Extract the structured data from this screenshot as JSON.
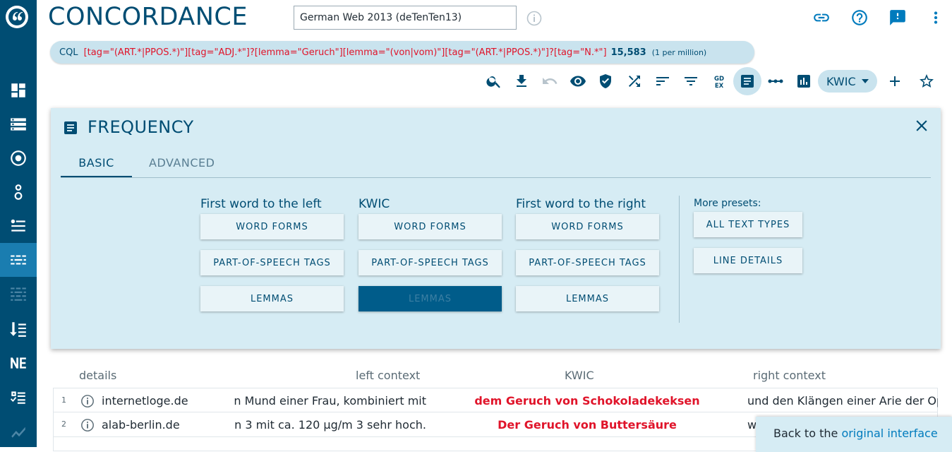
{
  "header": {
    "title": "CONCORDANCE",
    "corpus": "German Web 2013 (deTenTen13)"
  },
  "cql": {
    "label": "CQL",
    "query": "[tag=\"(ART.*|PPOS.*)\"][tag=\"ADJ.*\"]?[lemma=\"Geruch\"][lemma=\"(von|vom)\"][tag=\"(ART.*|PPOS.*)\"]?[tag=\"N.*\"]",
    "count": "15,583",
    "per_million": "(1 per million)"
  },
  "toolbar": {
    "view_mode": "KWIC"
  },
  "frequency": {
    "title": "FREQUENCY",
    "tabs": [
      "BASIC",
      "ADVANCED"
    ],
    "columns": [
      {
        "heading": "First word to the left",
        "buttons": [
          "WORD FORMS",
          "PART-OF-SPEECH TAGS",
          "LEMMAS"
        ]
      },
      {
        "heading": "KWIC",
        "buttons": [
          "WORD FORMS",
          "PART-OF-SPEECH TAGS",
          "LEMMAS"
        ]
      },
      {
        "heading": "First word to the right",
        "buttons": [
          "WORD FORMS",
          "PART-OF-SPEECH TAGS",
          "LEMMAS"
        ]
      }
    ],
    "presets_label": "More presets:",
    "presets": [
      "ALL TEXT TYPES",
      "LINE DETAILS"
    ]
  },
  "table": {
    "headers": [
      "details",
      "left context",
      "KWIC",
      "right context"
    ],
    "rows": [
      {
        "num": "1",
        "doc": "internetloge.de",
        "left": "n Mund einer Frau, kombiniert mit",
        "kwic": "dem Geruch von Schokoladekeksen",
        "right": "und den Klängen einer Arie der Op"
      },
      {
        "num": "2",
        "doc": "alab-berlin.de",
        "left": "n 3 mit ca. 120 µg/m 3 sehr hoch.",
        "kwic": "Der Geruch von Buttersäure",
        "right": "w"
      }
    ]
  },
  "banner": {
    "text": "Back to the",
    "link": "original interface"
  }
}
